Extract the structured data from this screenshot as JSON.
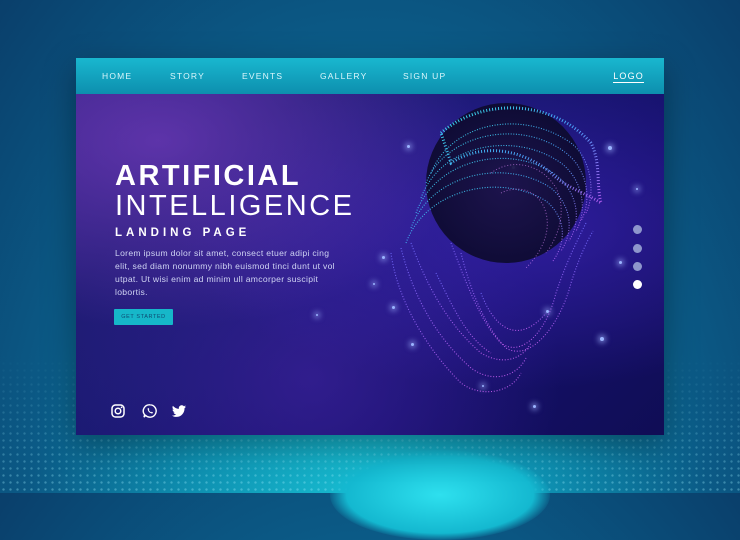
{
  "nav": {
    "items": [
      {
        "label": "HOME"
      },
      {
        "label": "STORY"
      },
      {
        "label": "EVENTS"
      },
      {
        "label": "GALLERY"
      },
      {
        "label": "SIGN UP"
      }
    ],
    "logo": "LOGO"
  },
  "hero": {
    "title_line1": "ARTIFICIAL",
    "title_line2": "INTELLIGENCE",
    "subtitle": "LANDING PAGE",
    "body": "Lorem ipsum dolor sit amet, consect etuer adipi cing elit, sed diam nonummy nibh euismod tinci dunt ut vol utpat. Ut wisi enim ad minim ull amcorper suscipit lobortis.",
    "cta_label": "GET STARTED"
  },
  "social": {
    "icons": [
      "instagram-icon",
      "whatsapp-icon",
      "twitter-icon"
    ]
  },
  "pagination": {
    "count": 4,
    "active_index": 3
  },
  "colors": {
    "accent": "#16b7c9",
    "nav_bar": "#0d8fae",
    "page_bg": "#1a1a72",
    "text": "#ffffff"
  }
}
